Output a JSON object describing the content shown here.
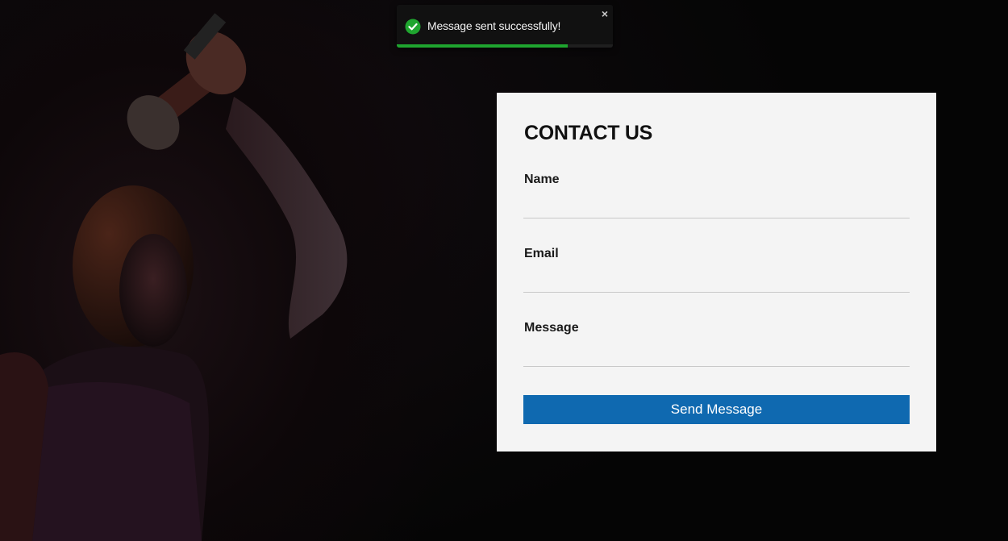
{
  "toast": {
    "message": "Message sent successfully!",
    "close_symbol": "×",
    "icon": "check-circle-icon",
    "progress_fraction": 0.79,
    "success_color": "#1fa52f"
  },
  "contact": {
    "title": "CONTACT US",
    "fields": {
      "name": {
        "label": "Name",
        "value": "",
        "placeholder": ""
      },
      "email": {
        "label": "Email",
        "value": "",
        "placeholder": ""
      },
      "message": {
        "label": "Message",
        "value": "",
        "placeholder": ""
      }
    },
    "submit_label": "Send Message",
    "accent_color": "#0f69b0"
  },
  "hero": {
    "image": "woman-lifting-dumbbell-photo"
  }
}
